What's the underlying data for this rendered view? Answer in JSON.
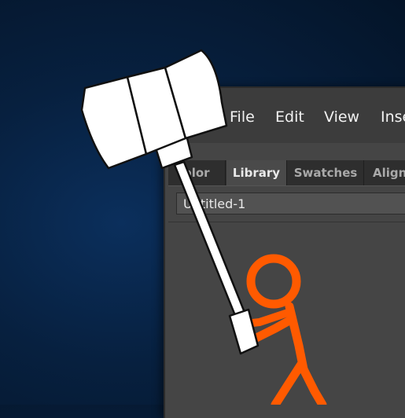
{
  "menubar": {
    "items": [
      {
        "label": "File"
      },
      {
        "label": "Edit"
      },
      {
        "label": "View"
      },
      {
        "label": "Inse"
      }
    ]
  },
  "panel": {
    "tabs": [
      {
        "label": "olor"
      },
      {
        "label": "Library"
      },
      {
        "label": "Swatches"
      },
      {
        "label": "Align"
      }
    ],
    "document_select": {
      "value": "Untitled-1"
    }
  },
  "colors": {
    "stick_figure": "#ff5a00",
    "hammer": "#ffffff",
    "desktop": "#07203f",
    "panel": "#454545"
  }
}
